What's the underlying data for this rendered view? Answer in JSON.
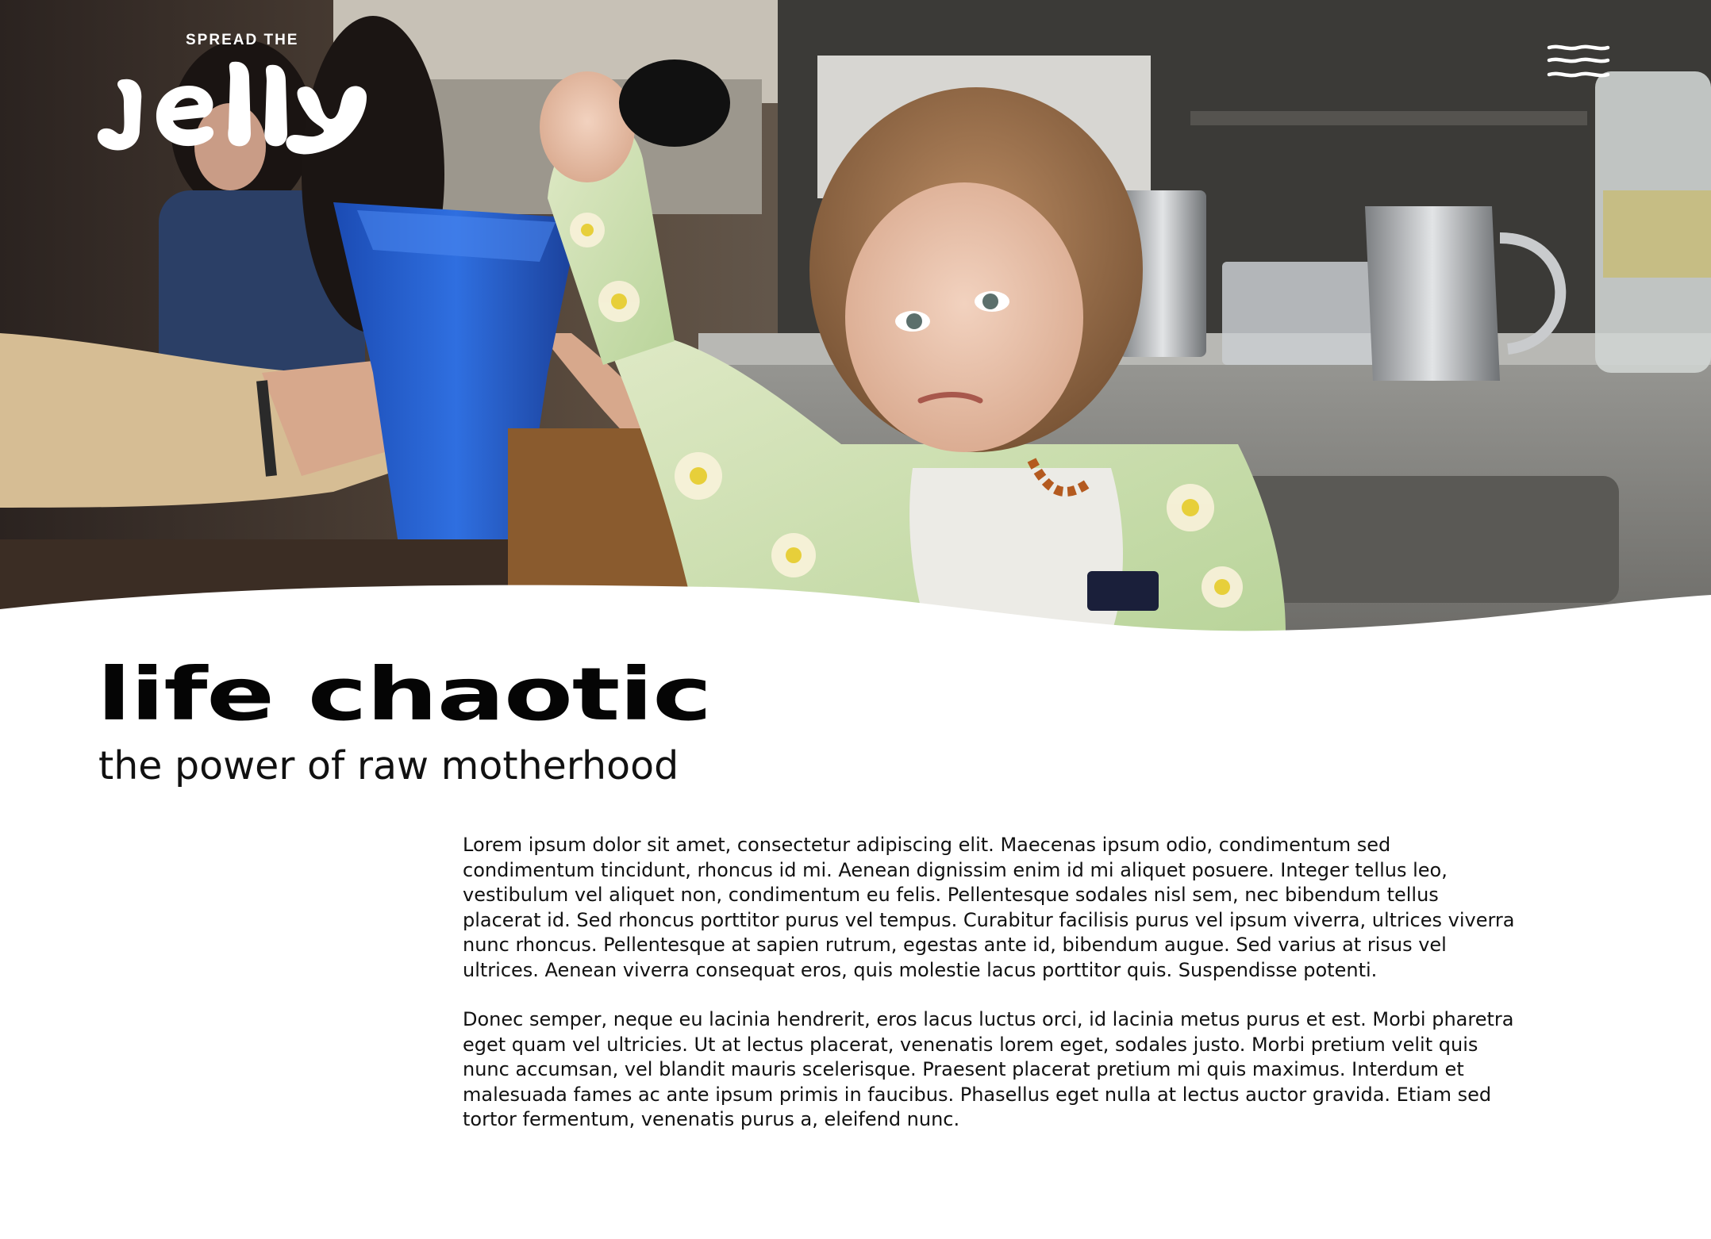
{
  "brand": {
    "kicker": "SPREAD THE",
    "name": "Jelly"
  },
  "nav": {
    "menu_icon": "wavy-hamburger-icon"
  },
  "hero": {
    "icon": "hero-photo"
  },
  "article": {
    "title": "life chaotic",
    "subtitle": "the power of raw motherhood",
    "paragraphs": [
      "Lorem ipsum dolor sit amet, consectetur adipiscing elit. Maecenas ipsum odio, condimentum sed condimentum tincidunt, rhoncus id mi. Aenean dignissim enim id mi aliquet posuere. Integer tellus leo, vestibulum vel aliquet non, condimentum eu felis. Pellentesque sodales nisl sem, nec bibendum tellus placerat id. Sed rhoncus porttitor purus vel tempus. Curabitur facilisis purus vel ipsum viverra, ultrices viverra nunc rhoncus. Pellentesque at sapien rutrum, egestas ante id, bibendum augue. Sed varius at risus vel ultrices. Aenean viverra consequat eros, quis molestie lacus porttitor quis. Suspendisse potenti.",
      "Donec semper, neque eu lacinia hendrerit, eros lacus luctus orci, id lacinia metus purus et est. Morbi pharetra eget quam vel ultricies. Ut at lectus placerat, venenatis lorem eget, sodales justo. Morbi pretium velit quis nunc accumsan, vel blandit mauris scelerisque. Praesent placerat pretium mi quis maximus. Interdum et malesuada fames ac ante ipsum primis in faucibus. Phasellus eget nulla at lectus auctor gravida. Etiam sed tortor fermentum, venenatis purus a, eleifend nunc."
    ]
  },
  "colors": {
    "background": "#ffffff",
    "text": "#0a0a0a",
    "logo": "#ffffff"
  }
}
